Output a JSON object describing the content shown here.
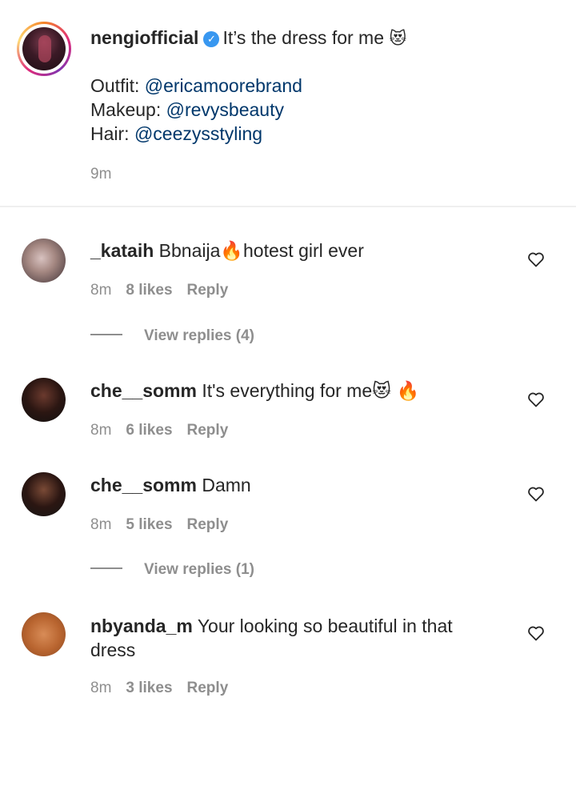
{
  "post": {
    "username": "nengiofficial",
    "caption": "It’s the dress for me",
    "caption_emoji": "😻",
    "credits": [
      {
        "label": "Outfit:",
        "mention": "@ericamoorebrand"
      },
      {
        "label": "Makeup:",
        "mention": "@revysbeauty"
      },
      {
        "label": "Hair:",
        "mention": "@ceezysstyling"
      }
    ],
    "time": "9m"
  },
  "comments": [
    {
      "username": "_kataih",
      "text": "Bbnaija🔥hotest girl ever",
      "time": "8m",
      "likes": "8 likes",
      "reply": "Reply",
      "view_replies": "View replies (4)"
    },
    {
      "username": "che__somm",
      "text": "It's everything for me😻 🔥",
      "time": "8m",
      "likes": "6 likes",
      "reply": "Reply"
    },
    {
      "username": "che__somm",
      "text": "Damn",
      "time": "8m",
      "likes": "5 likes",
      "reply": "Reply",
      "view_replies": "View replies (1)"
    },
    {
      "username": "nbyanda_m",
      "text": "Your looking so beautiful in that",
      "text_line2": "dress",
      "time": "8m",
      "likes": "3 likes",
      "reply": "Reply"
    }
  ],
  "icons": {
    "verified": "verified-badge-icon",
    "like": "heart-outline-icon"
  },
  "colors": {
    "mention": "#00376b",
    "verified": "#3897f0",
    "muted": "#8e8e8e"
  }
}
